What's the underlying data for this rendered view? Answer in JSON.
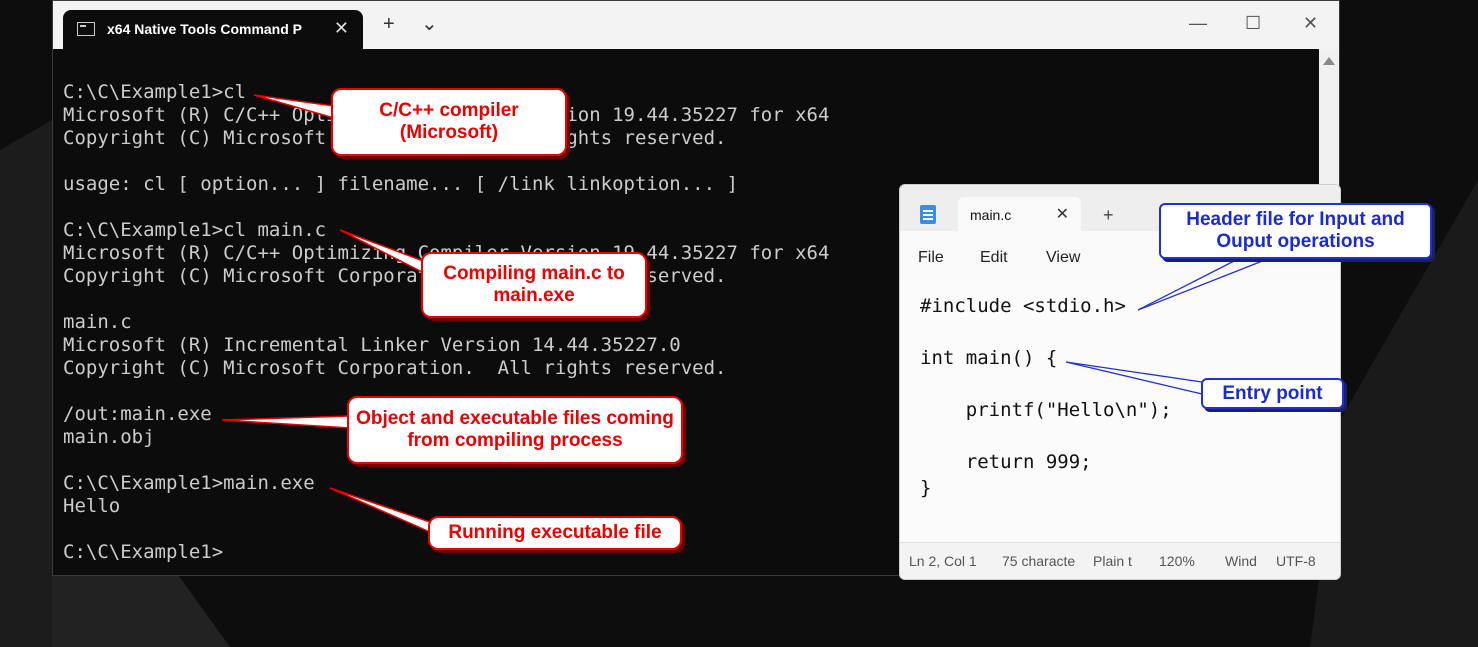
{
  "terminal": {
    "tab_title": "x64 Native Tools Command P",
    "tab_close": "✕",
    "new_tab": "+",
    "dropdown": "⌄",
    "minimize": "—",
    "maximize": "☐",
    "close": "✕",
    "lines": [
      "C:\\C\\Example1>cl",
      "Microsoft (R) C/C++ Optimizing Compiler Version 19.44.35227 for x64",
      "Copyright (C) Microsoft Corporation.  All rights reserved.",
      "",
      "usage: cl [ option... ] filename... [ /link linkoption... ]",
      "",
      "C:\\C\\Example1>cl main.c",
      "Microsoft (R) C/C++ Optimizing Compiler Version 19.44.35227 for x64",
      "Copyright (C) Microsoft Corporation.  All rights reserved.",
      "",
      "main.c",
      "Microsoft (R) Incremental Linker Version 14.44.35227.0",
      "Copyright (C) Microsoft Corporation.  All rights reserved.",
      "",
      "/out:main.exe",
      "main.obj",
      "",
      "C:\\C\\Example1>main.exe",
      "Hello",
      "",
      "C:\\C\\Example1>"
    ]
  },
  "notepad": {
    "tab_title": "main.c",
    "tab_close": "✕",
    "new_tab": "+",
    "menu": {
      "file": "File",
      "edit": "Edit",
      "view": "View"
    },
    "code": {
      "line1": "#include <stdio.h>",
      "line2": "int main() {",
      "line3": "    printf(\"Hello\\n\");",
      "line4": "    return 999;",
      "line5": "}"
    },
    "status": {
      "position": "Ln 2, Col 1",
      "chars": "75 characte",
      "format": "Plain t",
      "zoom": "120%",
      "line_ending": "Wind",
      "encoding": "UTF-8"
    }
  },
  "callouts": {
    "compiler": "C/C++ compiler (Microsoft)",
    "compiling": "Compiling main.c to main.exe",
    "objects": "Object and executable files coming from compiling process",
    "running": "Running executable file",
    "header": "Header file for Input and Ouput operations",
    "entry": "Entry point"
  },
  "colors": {
    "callout_red": "#ee0000",
    "callout_blue": "#1a2bd6",
    "terminal_bg": "#0c0c0c"
  }
}
